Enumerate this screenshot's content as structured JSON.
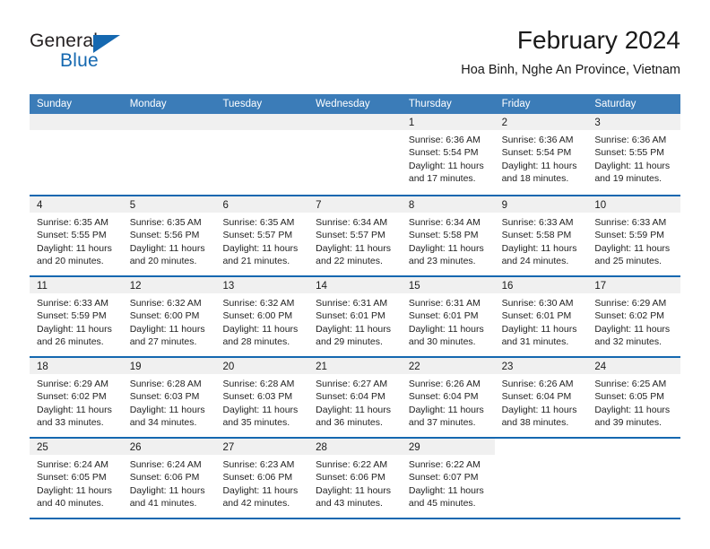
{
  "brand": {
    "name_part1": "General",
    "name_part2": "Blue",
    "triangle_icon": "triangle-icon",
    "accent_color": "#1568b0"
  },
  "header": {
    "title": "February 2024",
    "subtitle": "Hoa Binh, Nghe An Province, Vietnam"
  },
  "calendar": {
    "header_bg": "#3b7cb8",
    "row_divider_color": "#1568b0",
    "day_band_bg": "#f0f0f0",
    "weekdays": [
      "Sunday",
      "Monday",
      "Tuesday",
      "Wednesday",
      "Thursday",
      "Friday",
      "Saturday"
    ],
    "weeks": [
      [
        {
          "day": "",
          "lines": []
        },
        {
          "day": "",
          "lines": []
        },
        {
          "day": "",
          "lines": []
        },
        {
          "day": "",
          "lines": []
        },
        {
          "day": "1",
          "lines": [
            "Sunrise: 6:36 AM",
            "Sunset: 5:54 PM",
            "Daylight: 11 hours",
            "and 17 minutes."
          ]
        },
        {
          "day": "2",
          "lines": [
            "Sunrise: 6:36 AM",
            "Sunset: 5:54 PM",
            "Daylight: 11 hours",
            "and 18 minutes."
          ]
        },
        {
          "day": "3",
          "lines": [
            "Sunrise: 6:36 AM",
            "Sunset: 5:55 PM",
            "Daylight: 11 hours",
            "and 19 minutes."
          ]
        }
      ],
      [
        {
          "day": "4",
          "lines": [
            "Sunrise: 6:35 AM",
            "Sunset: 5:55 PM",
            "Daylight: 11 hours",
            "and 20 minutes."
          ]
        },
        {
          "day": "5",
          "lines": [
            "Sunrise: 6:35 AM",
            "Sunset: 5:56 PM",
            "Daylight: 11 hours",
            "and 20 minutes."
          ]
        },
        {
          "day": "6",
          "lines": [
            "Sunrise: 6:35 AM",
            "Sunset: 5:57 PM",
            "Daylight: 11 hours",
            "and 21 minutes."
          ]
        },
        {
          "day": "7",
          "lines": [
            "Sunrise: 6:34 AM",
            "Sunset: 5:57 PM",
            "Daylight: 11 hours",
            "and 22 minutes."
          ]
        },
        {
          "day": "8",
          "lines": [
            "Sunrise: 6:34 AM",
            "Sunset: 5:58 PM",
            "Daylight: 11 hours",
            "and 23 minutes."
          ]
        },
        {
          "day": "9",
          "lines": [
            "Sunrise: 6:33 AM",
            "Sunset: 5:58 PM",
            "Daylight: 11 hours",
            "and 24 minutes."
          ]
        },
        {
          "day": "10",
          "lines": [
            "Sunrise: 6:33 AM",
            "Sunset: 5:59 PM",
            "Daylight: 11 hours",
            "and 25 minutes."
          ]
        }
      ],
      [
        {
          "day": "11",
          "lines": [
            "Sunrise: 6:33 AM",
            "Sunset: 5:59 PM",
            "Daylight: 11 hours",
            "and 26 minutes."
          ]
        },
        {
          "day": "12",
          "lines": [
            "Sunrise: 6:32 AM",
            "Sunset: 6:00 PM",
            "Daylight: 11 hours",
            "and 27 minutes."
          ]
        },
        {
          "day": "13",
          "lines": [
            "Sunrise: 6:32 AM",
            "Sunset: 6:00 PM",
            "Daylight: 11 hours",
            "and 28 minutes."
          ]
        },
        {
          "day": "14",
          "lines": [
            "Sunrise: 6:31 AM",
            "Sunset: 6:01 PM",
            "Daylight: 11 hours",
            "and 29 minutes."
          ]
        },
        {
          "day": "15",
          "lines": [
            "Sunrise: 6:31 AM",
            "Sunset: 6:01 PM",
            "Daylight: 11 hours",
            "and 30 minutes."
          ]
        },
        {
          "day": "16",
          "lines": [
            "Sunrise: 6:30 AM",
            "Sunset: 6:01 PM",
            "Daylight: 11 hours",
            "and 31 minutes."
          ]
        },
        {
          "day": "17",
          "lines": [
            "Sunrise: 6:29 AM",
            "Sunset: 6:02 PM",
            "Daylight: 11 hours",
            "and 32 minutes."
          ]
        }
      ],
      [
        {
          "day": "18",
          "lines": [
            "Sunrise: 6:29 AM",
            "Sunset: 6:02 PM",
            "Daylight: 11 hours",
            "and 33 minutes."
          ]
        },
        {
          "day": "19",
          "lines": [
            "Sunrise: 6:28 AM",
            "Sunset: 6:03 PM",
            "Daylight: 11 hours",
            "and 34 minutes."
          ]
        },
        {
          "day": "20",
          "lines": [
            "Sunrise: 6:28 AM",
            "Sunset: 6:03 PM",
            "Daylight: 11 hours",
            "and 35 minutes."
          ]
        },
        {
          "day": "21",
          "lines": [
            "Sunrise: 6:27 AM",
            "Sunset: 6:04 PM",
            "Daylight: 11 hours",
            "and 36 minutes."
          ]
        },
        {
          "day": "22",
          "lines": [
            "Sunrise: 6:26 AM",
            "Sunset: 6:04 PM",
            "Daylight: 11 hours",
            "and 37 minutes."
          ]
        },
        {
          "day": "23",
          "lines": [
            "Sunrise: 6:26 AM",
            "Sunset: 6:04 PM",
            "Daylight: 11 hours",
            "and 38 minutes."
          ]
        },
        {
          "day": "24",
          "lines": [
            "Sunrise: 6:25 AM",
            "Sunset: 6:05 PM",
            "Daylight: 11 hours",
            "and 39 minutes."
          ]
        }
      ],
      [
        {
          "day": "25",
          "lines": [
            "Sunrise: 6:24 AM",
            "Sunset: 6:05 PM",
            "Daylight: 11 hours",
            "and 40 minutes."
          ]
        },
        {
          "day": "26",
          "lines": [
            "Sunrise: 6:24 AM",
            "Sunset: 6:06 PM",
            "Daylight: 11 hours",
            "and 41 minutes."
          ]
        },
        {
          "day": "27",
          "lines": [
            "Sunrise: 6:23 AM",
            "Sunset: 6:06 PM",
            "Daylight: 11 hours",
            "and 42 minutes."
          ]
        },
        {
          "day": "28",
          "lines": [
            "Sunrise: 6:22 AM",
            "Sunset: 6:06 PM",
            "Daylight: 11 hours",
            "and 43 minutes."
          ]
        },
        {
          "day": "29",
          "lines": [
            "Sunrise: 6:22 AM",
            "Sunset: 6:07 PM",
            "Daylight: 11 hours",
            "and 45 minutes."
          ]
        },
        {
          "day": "",
          "lines": []
        },
        {
          "day": "",
          "lines": []
        }
      ]
    ]
  }
}
